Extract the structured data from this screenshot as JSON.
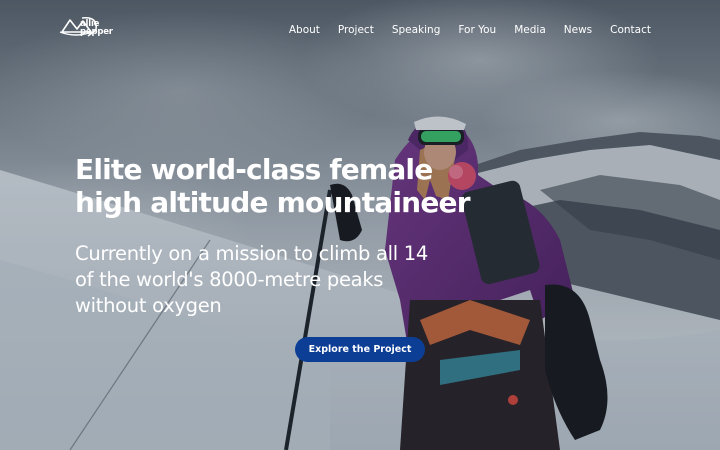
{
  "header": {
    "logo_lines": [
      "allie",
      "pepper"
    ],
    "nav": [
      "About",
      "Project",
      "Speaking",
      "For You",
      "Media",
      "News",
      "Contact"
    ]
  },
  "hero": {
    "headline_lines": [
      "Elite world-class female",
      "high altitude mountaineer"
    ],
    "subhead_lines": [
      "Currently on a mission to climb all 14",
      "of the world's 8000-metre peaks",
      "without oxygen"
    ],
    "cta_label": "Explore the Project",
    "cta_color": "#0d3e96"
  }
}
